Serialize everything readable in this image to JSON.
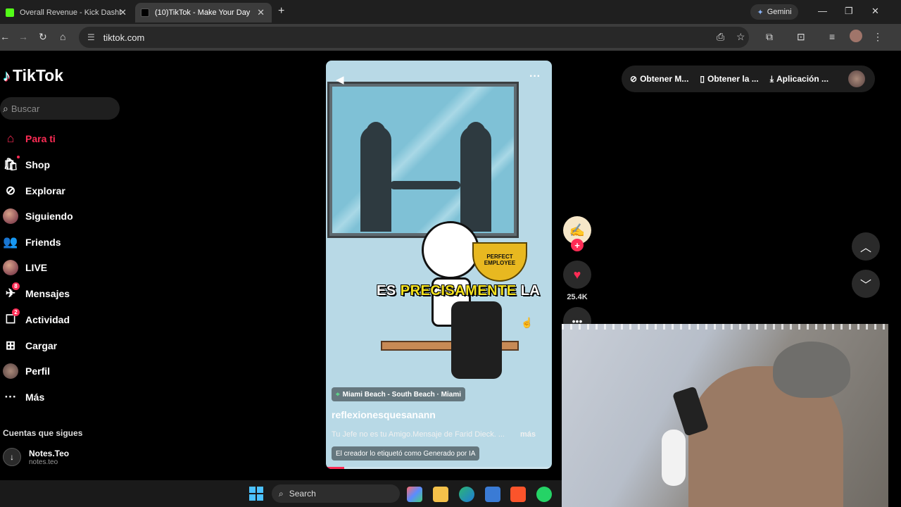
{
  "browser": {
    "tabs": [
      {
        "title": "Overall Revenue - Kick Dashboard",
        "favicon_color": "#53fc18",
        "active": false
      },
      {
        "title": "(10)TikTok - Make Your Day",
        "favicon_color": "#000000",
        "active": true
      }
    ],
    "gemini_label": "Gemini",
    "url": "tiktok.com"
  },
  "sidebar": {
    "logo": "TikTok",
    "search_placeholder": "Buscar",
    "items": [
      {
        "label": "Para ti",
        "icon": "home-icon"
      },
      {
        "label": "Shop",
        "icon": "shop-bag-icon"
      },
      {
        "label": "Explorar",
        "icon": "compass-icon"
      },
      {
        "label": "Siguiendo",
        "icon": "avatar-icon"
      },
      {
        "label": "Friends",
        "icon": "friends-icon"
      },
      {
        "label": "LIVE",
        "icon": "avatar-icon"
      },
      {
        "label": "Mensajes",
        "icon": "send-icon",
        "badge": "8"
      },
      {
        "label": "Actividad",
        "icon": "inbox-icon",
        "badge": "2"
      },
      {
        "label": "Cargar",
        "icon": "upload-icon"
      },
      {
        "label": "Perfil",
        "icon": "avatar-icon"
      },
      {
        "label": "Más",
        "icon": "more-icon"
      }
    ],
    "following_heading": "Cuentas que sigues",
    "following": [
      {
        "name": "Notes.Teo",
        "handle": "notes.teo"
      }
    ]
  },
  "video": {
    "caption_white": "ES ",
    "caption_yellow": "PRECISAMENTE",
    "caption_end": " LA",
    "trophy_text": "PERFECT EMPLOYEE",
    "location": "Miami Beach - South Beach · Miami",
    "author": "reflexionesquesanann",
    "description": "Tu Jefe no es tu Amigo.Mensaje de Farid Dieck. ...",
    "more_label": "más",
    "ai_label": "El creador lo etiquetó como Generado por IA",
    "progress": 0.08
  },
  "actions": {
    "like_count": "25.4K"
  },
  "top_pill": {
    "items": [
      "Obtener M...",
      "Obtener la ...",
      "Aplicación ..."
    ]
  },
  "taskbar": {
    "search_label": "Search"
  }
}
